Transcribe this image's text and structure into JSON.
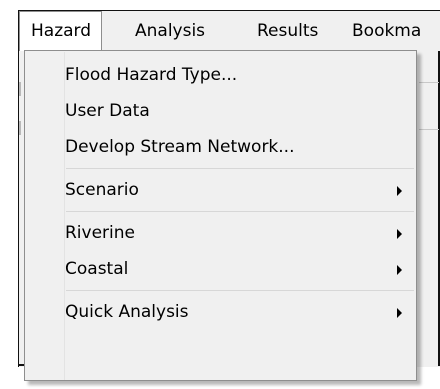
{
  "menubar": {
    "items": [
      {
        "label": "Hazard",
        "active": true
      },
      {
        "label": "Analysis",
        "active": false
      },
      {
        "label": "Results",
        "active": false
      },
      {
        "label": "Bookma",
        "active": false
      }
    ]
  },
  "dropdown": {
    "items": [
      {
        "label": "Flood Hazard Type...",
        "has_submenu": false
      },
      {
        "label": "User Data",
        "has_submenu": false
      },
      {
        "label": "Develop Stream Network...",
        "has_submenu": false
      },
      {
        "label": "Scenario",
        "has_submenu": true,
        "arrow_icon": "chevron-right-icon"
      },
      {
        "label": "Riverine",
        "has_submenu": true,
        "arrow_icon": "chevron-right-icon"
      },
      {
        "label": "Coastal",
        "has_submenu": true,
        "arrow_icon": "chevron-right-icon"
      },
      {
        "label": "Quick Analysis",
        "has_submenu": true,
        "arrow_icon": "chevron-right-icon"
      }
    ]
  },
  "colors": {
    "menu_background": "#f0f0f0",
    "active_menu_background": "#ffffff",
    "border": "#8e8e8e",
    "separator": "#d7d7d7"
  }
}
